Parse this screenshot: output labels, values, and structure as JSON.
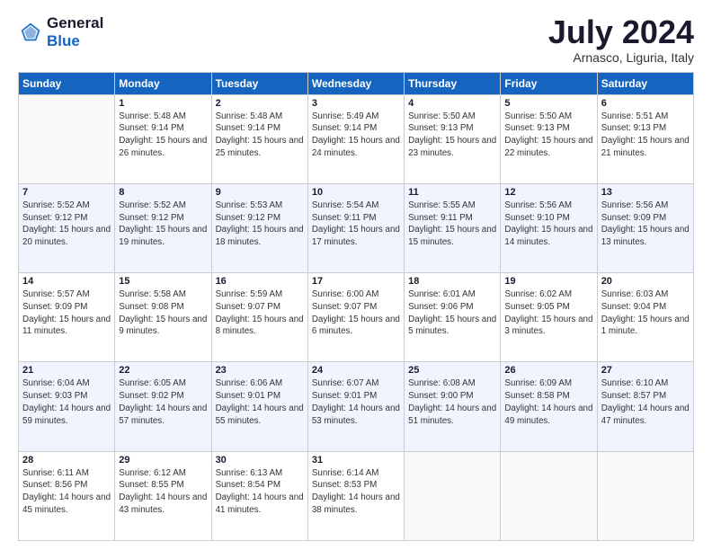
{
  "header": {
    "logo_general": "General",
    "logo_blue": "Blue",
    "month_title": "July 2024",
    "location": "Arnasco, Liguria, Italy"
  },
  "weekdays": [
    "Sunday",
    "Monday",
    "Tuesday",
    "Wednesday",
    "Thursday",
    "Friday",
    "Saturday"
  ],
  "weeks": [
    [
      {
        "day": "",
        "sunrise": "",
        "sunset": "",
        "daylight": ""
      },
      {
        "day": "1",
        "sunrise": "Sunrise: 5:48 AM",
        "sunset": "Sunset: 9:14 PM",
        "daylight": "Daylight: 15 hours and 26 minutes."
      },
      {
        "day": "2",
        "sunrise": "Sunrise: 5:48 AM",
        "sunset": "Sunset: 9:14 PM",
        "daylight": "Daylight: 15 hours and 25 minutes."
      },
      {
        "day": "3",
        "sunrise": "Sunrise: 5:49 AM",
        "sunset": "Sunset: 9:14 PM",
        "daylight": "Daylight: 15 hours and 24 minutes."
      },
      {
        "day": "4",
        "sunrise": "Sunrise: 5:50 AM",
        "sunset": "Sunset: 9:13 PM",
        "daylight": "Daylight: 15 hours and 23 minutes."
      },
      {
        "day": "5",
        "sunrise": "Sunrise: 5:50 AM",
        "sunset": "Sunset: 9:13 PM",
        "daylight": "Daylight: 15 hours and 22 minutes."
      },
      {
        "day": "6",
        "sunrise": "Sunrise: 5:51 AM",
        "sunset": "Sunset: 9:13 PM",
        "daylight": "Daylight: 15 hours and 21 minutes."
      }
    ],
    [
      {
        "day": "7",
        "sunrise": "Sunrise: 5:52 AM",
        "sunset": "Sunset: 9:12 PM",
        "daylight": "Daylight: 15 hours and 20 minutes."
      },
      {
        "day": "8",
        "sunrise": "Sunrise: 5:52 AM",
        "sunset": "Sunset: 9:12 PM",
        "daylight": "Daylight: 15 hours and 19 minutes."
      },
      {
        "day": "9",
        "sunrise": "Sunrise: 5:53 AM",
        "sunset": "Sunset: 9:12 PM",
        "daylight": "Daylight: 15 hours and 18 minutes."
      },
      {
        "day": "10",
        "sunrise": "Sunrise: 5:54 AM",
        "sunset": "Sunset: 9:11 PM",
        "daylight": "Daylight: 15 hours and 17 minutes."
      },
      {
        "day": "11",
        "sunrise": "Sunrise: 5:55 AM",
        "sunset": "Sunset: 9:11 PM",
        "daylight": "Daylight: 15 hours and 15 minutes."
      },
      {
        "day": "12",
        "sunrise": "Sunrise: 5:56 AM",
        "sunset": "Sunset: 9:10 PM",
        "daylight": "Daylight: 15 hours and 14 minutes."
      },
      {
        "day": "13",
        "sunrise": "Sunrise: 5:56 AM",
        "sunset": "Sunset: 9:09 PM",
        "daylight": "Daylight: 15 hours and 13 minutes."
      }
    ],
    [
      {
        "day": "14",
        "sunrise": "Sunrise: 5:57 AM",
        "sunset": "Sunset: 9:09 PM",
        "daylight": "Daylight: 15 hours and 11 minutes."
      },
      {
        "day": "15",
        "sunrise": "Sunrise: 5:58 AM",
        "sunset": "Sunset: 9:08 PM",
        "daylight": "Daylight: 15 hours and 9 minutes."
      },
      {
        "day": "16",
        "sunrise": "Sunrise: 5:59 AM",
        "sunset": "Sunset: 9:07 PM",
        "daylight": "Daylight: 15 hours and 8 minutes."
      },
      {
        "day": "17",
        "sunrise": "Sunrise: 6:00 AM",
        "sunset": "Sunset: 9:07 PM",
        "daylight": "Daylight: 15 hours and 6 minutes."
      },
      {
        "day": "18",
        "sunrise": "Sunrise: 6:01 AM",
        "sunset": "Sunset: 9:06 PM",
        "daylight": "Daylight: 15 hours and 5 minutes."
      },
      {
        "day": "19",
        "sunrise": "Sunrise: 6:02 AM",
        "sunset": "Sunset: 9:05 PM",
        "daylight": "Daylight: 15 hours and 3 minutes."
      },
      {
        "day": "20",
        "sunrise": "Sunrise: 6:03 AM",
        "sunset": "Sunset: 9:04 PM",
        "daylight": "Daylight: 15 hours and 1 minute."
      }
    ],
    [
      {
        "day": "21",
        "sunrise": "Sunrise: 6:04 AM",
        "sunset": "Sunset: 9:03 PM",
        "daylight": "Daylight: 14 hours and 59 minutes."
      },
      {
        "day": "22",
        "sunrise": "Sunrise: 6:05 AM",
        "sunset": "Sunset: 9:02 PM",
        "daylight": "Daylight: 14 hours and 57 minutes."
      },
      {
        "day": "23",
        "sunrise": "Sunrise: 6:06 AM",
        "sunset": "Sunset: 9:01 PM",
        "daylight": "Daylight: 14 hours and 55 minutes."
      },
      {
        "day": "24",
        "sunrise": "Sunrise: 6:07 AM",
        "sunset": "Sunset: 9:01 PM",
        "daylight": "Daylight: 14 hours and 53 minutes."
      },
      {
        "day": "25",
        "sunrise": "Sunrise: 6:08 AM",
        "sunset": "Sunset: 9:00 PM",
        "daylight": "Daylight: 14 hours and 51 minutes."
      },
      {
        "day": "26",
        "sunrise": "Sunrise: 6:09 AM",
        "sunset": "Sunset: 8:58 PM",
        "daylight": "Daylight: 14 hours and 49 minutes."
      },
      {
        "day": "27",
        "sunrise": "Sunrise: 6:10 AM",
        "sunset": "Sunset: 8:57 PM",
        "daylight": "Daylight: 14 hours and 47 minutes."
      }
    ],
    [
      {
        "day": "28",
        "sunrise": "Sunrise: 6:11 AM",
        "sunset": "Sunset: 8:56 PM",
        "daylight": "Daylight: 14 hours and 45 minutes."
      },
      {
        "day": "29",
        "sunrise": "Sunrise: 6:12 AM",
        "sunset": "Sunset: 8:55 PM",
        "daylight": "Daylight: 14 hours and 43 minutes."
      },
      {
        "day": "30",
        "sunrise": "Sunrise: 6:13 AM",
        "sunset": "Sunset: 8:54 PM",
        "daylight": "Daylight: 14 hours and 41 minutes."
      },
      {
        "day": "31",
        "sunrise": "Sunrise: 6:14 AM",
        "sunset": "Sunset: 8:53 PM",
        "daylight": "Daylight: 14 hours and 38 minutes."
      },
      {
        "day": "",
        "sunrise": "",
        "sunset": "",
        "daylight": ""
      },
      {
        "day": "",
        "sunrise": "",
        "sunset": "",
        "daylight": ""
      },
      {
        "day": "",
        "sunrise": "",
        "sunset": "",
        "daylight": ""
      }
    ]
  ]
}
